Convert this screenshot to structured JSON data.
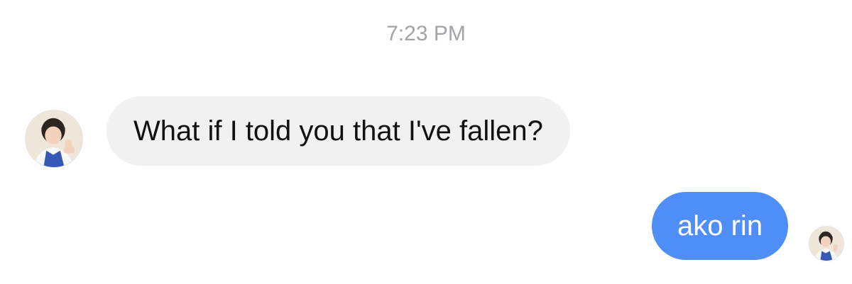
{
  "conversation": {
    "timestamp": "7:23 PM",
    "messages": [
      {
        "direction": "incoming",
        "text": "What if I told you that I've fallen?",
        "bubble_color": "#f1f1f2",
        "text_color": "#111111"
      },
      {
        "direction": "outgoing",
        "text": "ako rin",
        "bubble_color": "#4f8ef7",
        "text_color": "#ffffff"
      }
    ]
  },
  "icons": {
    "incoming_avatar": "avatar-icon",
    "outgoing_avatar": "avatar-icon"
  },
  "colors": {
    "timestamp": "#a3a3a8",
    "background": "#ffffff"
  }
}
